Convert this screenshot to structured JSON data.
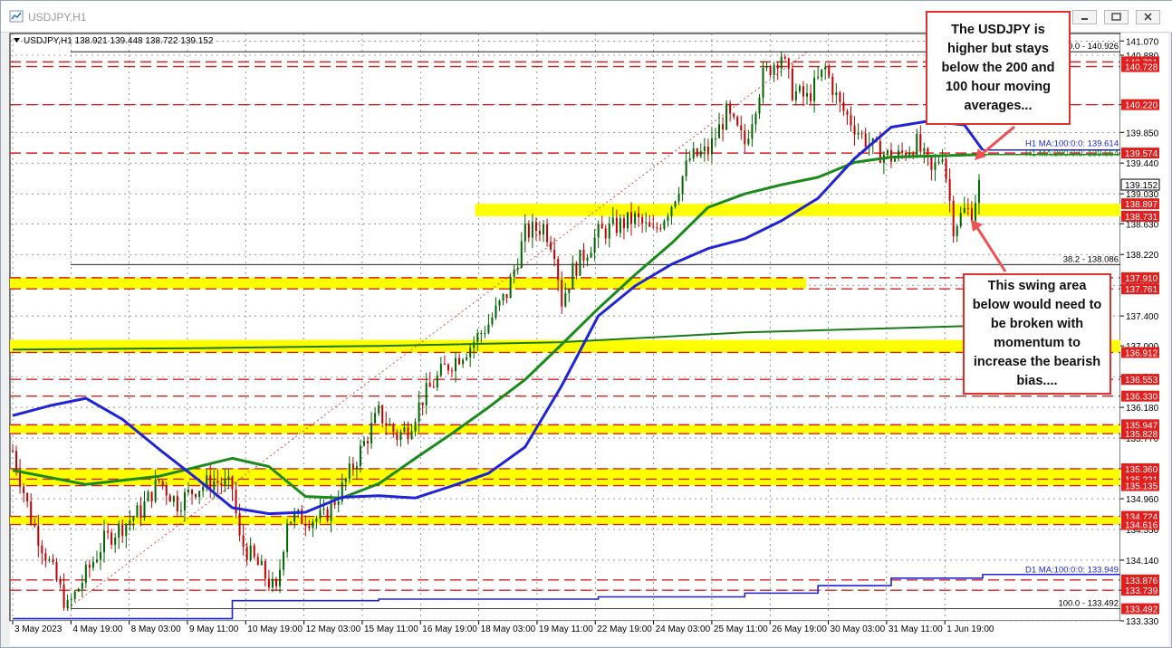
{
  "window": {
    "title": "USDJPY,H1",
    "buttons": [
      "minimize-button",
      "maximize-button",
      "close-button"
    ]
  },
  "colors": {
    "candle": "#000000",
    "bull": "#006400",
    "bear": "#c00000",
    "ma100": "#1f24d6",
    "ma200": "#1a8a1a",
    "daily_ma": "#1f24d6",
    "zone": "#ffff00",
    "resistance": "#d62020",
    "fib": "#000000"
  },
  "chart_data": {
    "type": "candlestick",
    "symbol_header": "USDJPY,H1",
    "ohlc_header": "138.921 139.448 138.722 139.152",
    "ylim": [
      133.33,
      141.17
    ],
    "y_ticks": [
      "141.070",
      "140.880",
      "140.220",
      "139.850",
      "139.440",
      "139.030",
      "138.630",
      "138.220",
      "137.810",
      "137.400",
      "137.000",
      "136.590",
      "136.180",
      "135.770",
      "135.360",
      "134.960",
      "134.550",
      "134.140",
      "133.740",
      "133.330"
    ],
    "x_labels": [
      "3 May 2023",
      "4 May 19:00",
      "8 May 03:00",
      "9 May 11:00",
      "10 May 19:00",
      "12 May 03:00",
      "15 May 11:00",
      "16 May 19:00",
      "18 May 03:00",
      "19 May 11:00",
      "22 May 19:00",
      "24 May 03:00",
      "25 May 11:00",
      "26 May 19:00",
      "30 May 03:00",
      "31 May 11:00",
      "1 Jun 19:00"
    ],
    "price_flags": [
      {
        "label": "140.791",
        "kind": "red"
      },
      {
        "label": "140.728",
        "kind": "red"
      },
      {
        "label": "140.220",
        "kind": "red"
      },
      {
        "label": "139.574",
        "kind": "red"
      },
      {
        "label": "139.152",
        "kind": "current"
      },
      {
        "label": "138.897",
        "kind": "red"
      },
      {
        "label": "138.731",
        "kind": "red"
      },
      {
        "label": "137.910",
        "kind": "red"
      },
      {
        "label": "137.761",
        "kind": "red"
      },
      {
        "label": "136.912",
        "kind": "red"
      },
      {
        "label": "136.553",
        "kind": "red"
      },
      {
        "label": "136.330",
        "kind": "red"
      },
      {
        "label": "135.947",
        "kind": "red"
      },
      {
        "label": "135.828",
        "kind": "red"
      },
      {
        "label": "135.360",
        "kind": "red"
      },
      {
        "label": "135.221",
        "kind": "red"
      },
      {
        "label": "135.135",
        "kind": "red"
      },
      {
        "label": "134.724",
        "kind": "red"
      },
      {
        "label": "134.616",
        "kind": "red"
      },
      {
        "label": "133.876",
        "kind": "red"
      },
      {
        "label": "133.739",
        "kind": "red"
      },
      {
        "label": "133.492",
        "kind": "red"
      }
    ],
    "zones": [
      {
        "from": 138.731,
        "to": 138.897,
        "start": "18 May 03:00"
      },
      {
        "from": 137.761,
        "to": 137.91,
        "start": "3 May 2023",
        "end": "26 May 19:00"
      },
      {
        "from": 136.912,
        "to": 137.08,
        "start": "3 May 2023"
      },
      {
        "from": 135.828,
        "to": 135.947,
        "start": "3 May 2023"
      },
      {
        "from": 135.135,
        "to": 135.36,
        "start": "3 May 2023"
      },
      {
        "from": 134.616,
        "to": 134.724,
        "start": "3 May 2023"
      }
    ],
    "red_lines": [
      140.791,
      140.728,
      140.22,
      139.574,
      137.91,
      137.761,
      136.912,
      136.553,
      136.33,
      135.947,
      135.828,
      135.36,
      135.221,
      135.135,
      134.724,
      134.616,
      133.876,
      133.739
    ],
    "fibonacci": [
      {
        "label": "0.0 - 140.926",
        "price": 140.926
      },
      {
        "label": "38.2 - 138.086",
        "price": 138.086
      },
      {
        "label": "100.0 - 133.492",
        "price": 133.492
      }
    ],
    "ma_labels": [
      {
        "label": "H1 MA:100:0:0: 139.614",
        "color": "blue"
      },
      {
        "label": "H1 MA:200:0:0: 139.554",
        "color": "green"
      },
      {
        "label": "D1 MA:100:0:0: 133.949",
        "color": "blue"
      }
    ],
    "ma100_h1": [
      [
        0,
        136.07
      ],
      [
        10,
        136.2
      ],
      [
        20,
        136.3
      ],
      [
        30,
        136.02
      ],
      [
        40,
        135.62
      ],
      [
        50,
        135.24
      ],
      [
        60,
        134.84
      ],
      [
        70,
        134.76
      ],
      [
        80,
        134.78
      ],
      [
        90,
        134.98
      ],
      [
        100,
        135.0
      ],
      [
        110,
        134.97
      ],
      [
        120,
        135.13
      ],
      [
        130,
        135.3
      ],
      [
        140,
        135.65
      ],
      [
        150,
        136.47
      ],
      [
        160,
        137.4
      ],
      [
        170,
        137.8
      ],
      [
        180,
        138.09
      ],
      [
        190,
        138.3
      ],
      [
        200,
        138.43
      ],
      [
        210,
        138.67
      ],
      [
        220,
        138.97
      ],
      [
        230,
        139.5
      ],
      [
        240,
        139.92
      ],
      [
        250,
        140.0
      ],
      [
        260,
        139.95
      ],
      [
        265,
        139.614
      ]
    ],
    "ma200_h1": [
      [
        0,
        135.34
      ],
      [
        20,
        135.15
      ],
      [
        40,
        135.26
      ],
      [
        60,
        135.5
      ],
      [
        70,
        135.39
      ],
      [
        80,
        134.99
      ],
      [
        90,
        134.97
      ],
      [
        100,
        135.16
      ],
      [
        110,
        135.5
      ],
      [
        120,
        135.83
      ],
      [
        130,
        136.18
      ],
      [
        140,
        136.55
      ],
      [
        150,
        137.02
      ],
      [
        160,
        137.5
      ],
      [
        170,
        137.95
      ],
      [
        180,
        138.37
      ],
      [
        190,
        138.85
      ],
      [
        200,
        139.03
      ],
      [
        210,
        139.15
      ],
      [
        220,
        139.25
      ],
      [
        230,
        139.45
      ],
      [
        240,
        139.52
      ],
      [
        265,
        139.554
      ]
    ],
    "ma100_d1": [
      [
        0,
        133.36
      ],
      [
        60,
        133.6
      ],
      [
        100,
        133.62
      ],
      [
        160,
        133.65
      ],
      [
        200,
        133.7
      ],
      [
        220,
        133.8
      ],
      [
        240,
        133.9
      ],
      [
        265,
        133.949
      ]
    ],
    "green_long_ma": [
      [
        0,
        136.95
      ],
      [
        50,
        136.97
      ],
      [
        100,
        137.0
      ],
      [
        150,
        137.05
      ],
      [
        200,
        137.18
      ],
      [
        265,
        137.27
      ]
    ],
    "path": [
      [
        0,
        135.6
      ],
      [
        5,
        134.7
      ],
      [
        15,
        133.5
      ],
      [
        25,
        134.4
      ],
      [
        35,
        134.8
      ],
      [
        40,
        135.2
      ],
      [
        45,
        134.9
      ],
      [
        50,
        135.1
      ],
      [
        55,
        135.2
      ],
      [
        60,
        135.1
      ],
      [
        62,
        134.4
      ],
      [
        68,
        134.0
      ],
      [
        72,
        133.7
      ],
      [
        75,
        134.7
      ],
      [
        85,
        134.7
      ],
      [
        90,
        135.1
      ],
      [
        95,
        135.6
      ],
      [
        100,
        136.1
      ],
      [
        105,
        135.8
      ],
      [
        108,
        135.9
      ],
      [
        112,
        136.3
      ],
      [
        118,
        136.7
      ],
      [
        125,
        137.0
      ],
      [
        130,
        137.3
      ],
      [
        135,
        137.7
      ],
      [
        140,
        138.5
      ],
      [
        145,
        138.6
      ],
      [
        148,
        138.3
      ],
      [
        150,
        137.6
      ],
      [
        153,
        138.0
      ],
      [
        160,
        138.5
      ],
      [
        170,
        138.7
      ],
      [
        175,
        138.5
      ],
      [
        180,
        138.9
      ],
      [
        185,
        139.5
      ],
      [
        190,
        139.6
      ],
      [
        195,
        140.1
      ],
      [
        200,
        139.7
      ],
      [
        205,
        140.6
      ],
      [
        210,
        140.9
      ],
      [
        213,
        140.4
      ],
      [
        217,
        140.3
      ],
      [
        222,
        140.7
      ],
      [
        226,
        140.2
      ],
      [
        232,
        139.8
      ],
      [
        236,
        139.6
      ],
      [
        241,
        139.5
      ],
      [
        247,
        139.7
      ],
      [
        251,
        139.3
      ],
      [
        254,
        139.6
      ],
      [
        257,
        138.6
      ],
      [
        260,
        138.8
      ],
      [
        262,
        138.8
      ],
      [
        264,
        139.15
      ]
    ],
    "callouts": [
      {
        "name": "callout-top",
        "text": "The USDJPY is higher but stays below the 200 and 100 hour moving averages..."
      },
      {
        "name": "callout-bottom",
        "text": "This swing area below would need to be broken with momentum to increase the bearish bias...."
      }
    ],
    "legend": null,
    "grid": true
  }
}
